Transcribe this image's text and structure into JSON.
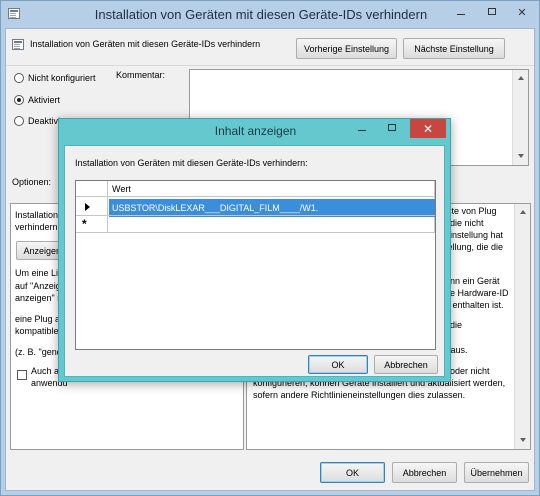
{
  "main_window": {
    "title": "Installation von Geräten mit diesen Geräte-IDs verhindern",
    "policy_name": "Installation von Geräten mit diesen Geräte-IDs verhindern",
    "prev_button": "Vorherige Einstellung",
    "next_button": "Nächste Einstellung",
    "radio_not_configured": "Nicht konfiguriert",
    "radio_enabled": "Aktiviert",
    "radio_disabled": "Deaktiviert",
    "comment_label": "Kommentar:",
    "options_label": "Optionen:",
    "options_text_1": "Installation",
    "options_text_2": "verhindern:",
    "show_button": "Anzeigen...",
    "options_desc_1": "Um eine Lis",
    "options_desc_2": "auf \"Anzeig",
    "options_desc_3": "anzeigen\" i",
    "options_desc_4": "eine Plug a",
    "options_desc_5": "kompatible",
    "options_desc_6": "(z. B. \"gend",
    "checkbox_text_1": "Auch au",
    "checkbox_text_2": "anwendu",
    "help_lines": [
      "iste von Plug",
      ", die nicht",
      "einstellung hat",
      "tellung, die die",
      "ann ein Gerät",
      "he Hardware-ID",
      "e enthalten ist.",
      "f die",
      "r aus.",
      ", oder nicht",
      "konfigurieren, können Geräte installiert und aktualisiert werden,",
      "sofern andere Richtlinieneinstellungen dies zulassen."
    ],
    "ok_button": "OK",
    "cancel_button": "Abbrechen",
    "apply_button": "Übernehmen"
  },
  "dialog": {
    "title": "Inhalt anzeigen",
    "label": "Installation von Geräten mit diesen Geräte-IDs verhindern:",
    "column_header": "Wert",
    "rows": [
      "USBSTOR\\DiskLEXAR___DIGITAL_FILM____/W1."
    ],
    "new_row_marker": "*",
    "ok_button": "OK",
    "cancel_button": "Abbrechen",
    "close_glyph": "✕"
  }
}
